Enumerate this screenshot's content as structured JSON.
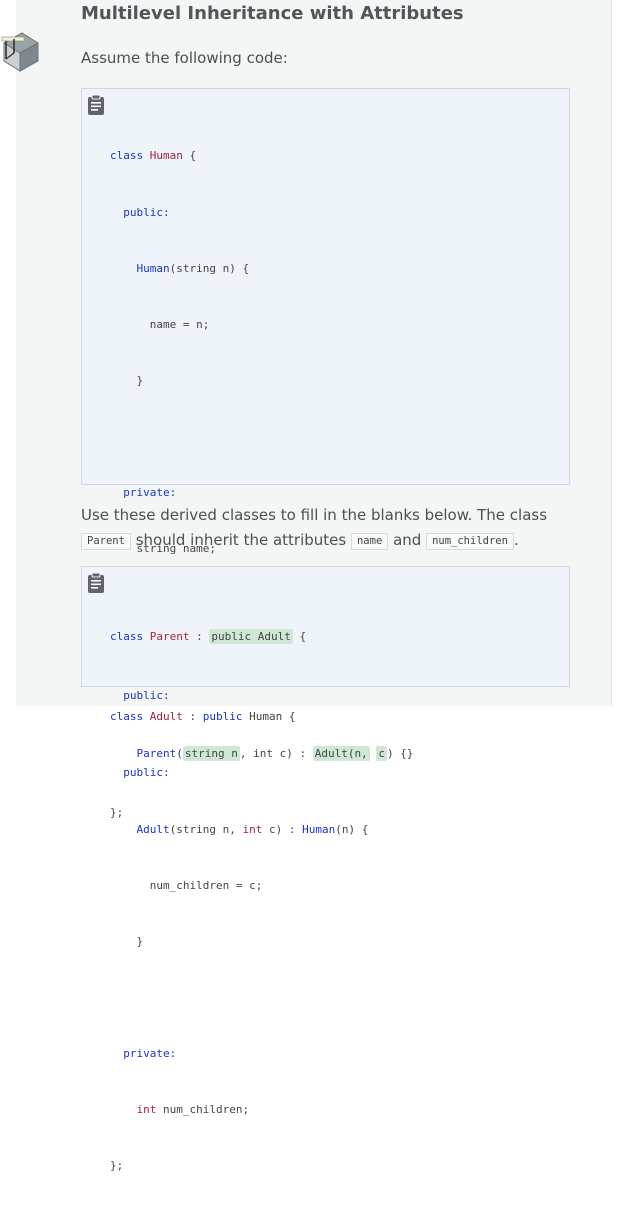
{
  "header": {
    "title": "Multilevel Inheritance with Attributes"
  },
  "intro": "Assume the following code:",
  "code_block_1": {
    "icon": "clipboard-icon",
    "lines": [
      "class Human {",
      "  public:",
      "    Human(string n) {",
      "      name = n;",
      "    }",
      "",
      "  private:",
      "    string name;",
      "};",
      "",
      "class Adult : public Human {",
      "  public:",
      "    Adult(string n, int c) : Human(n) {",
      "      num_children = c;",
      "    }",
      "",
      "  private:",
      "    int num_children;",
      "};"
    ]
  },
  "instructions": {
    "before_parent": "Use these derived classes to fill in the blanks below. The class",
    "parent_code": "Parent",
    "middle": "should inherit the attributes",
    "name_code": "name",
    "and": "and",
    "num_children_code": "num_children",
    "end": "."
  },
  "code_block_2": {
    "icon": "clipboard-icon",
    "line1_class": "class",
    "line1_name": "Parent",
    "line1_colon": ":",
    "blank_1": "public Adult",
    "line1_brace": "{",
    "line2": "public:",
    "line3_fn": "Parent(",
    "blank_2": "string n",
    "line3_mid": ", int c) :",
    "blank_3": "Adult(n,",
    "blank_4": "c",
    "line3_end": ") {}",
    "line4": "};"
  }
}
